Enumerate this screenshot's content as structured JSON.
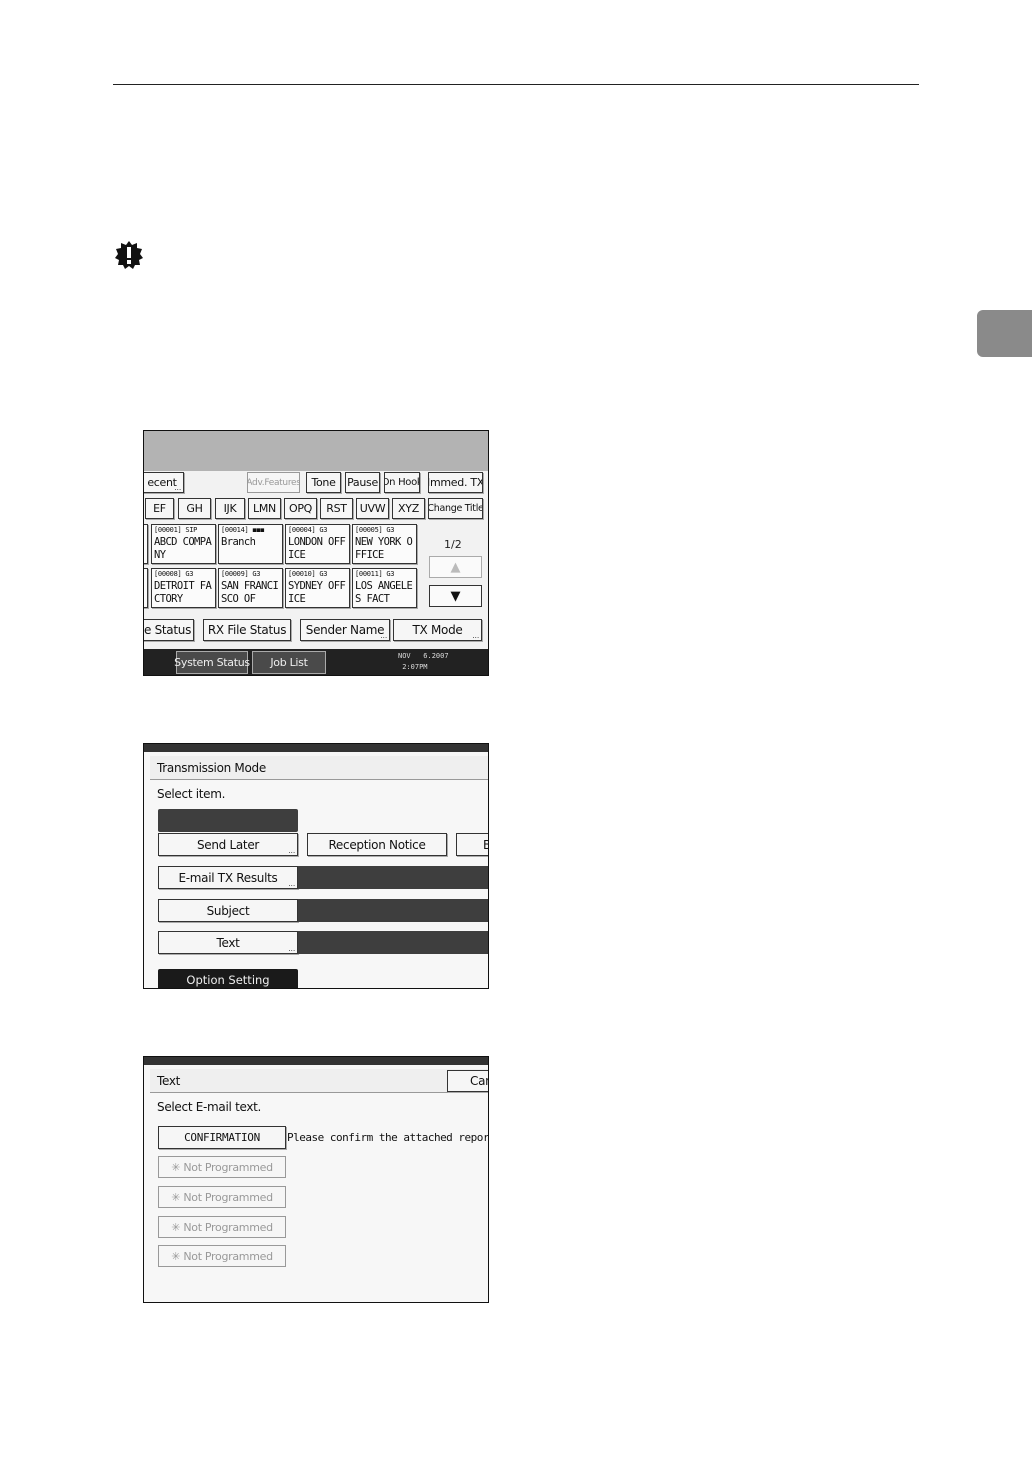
{
  "screen1": {
    "top_buttons": [
      "ecent",
      "Adv.Features",
      "Tone",
      "Pause",
      "On Hook",
      "Immed. TX"
    ],
    "index_tabs": [
      "EF",
      "GH",
      "IJK",
      "LMN",
      "OPQ",
      "RST",
      "UVW",
      "XYZ",
      "Change Title"
    ],
    "destinations": [
      {
        "code": "[00001] SIP",
        "name": "ABCD COMPA\nNY"
      },
      {
        "code": "[00014] ◼◼◼",
        "name": "Branch"
      },
      {
        "code": "[00004] G3",
        "name": "LONDON OFF\nICE"
      },
      {
        "code": "[00005] G3",
        "name": "NEW YORK O\nFFICE"
      },
      {
        "code": "[00008] G3",
        "name": "DETROIT FA\nCTORY"
      },
      {
        "code": "[00009] G3",
        "name": "SAN FRANCI\nSCO OF"
      },
      {
        "code": "[00010] G3",
        "name": "SYDNEY OFF\nICE"
      },
      {
        "code": "[00011] G3",
        "name": "LOS ANGELE\nS FACT"
      }
    ],
    "page_counter": "1/2",
    "up_arrow": "▲",
    "down_arrow": "▼",
    "bottom_buttons": [
      "le Status",
      "RX File Status",
      "Sender Name",
      "TX Mode"
    ],
    "status_buttons": [
      "System Status",
      "Job List"
    ],
    "datetime": "NOV   6.2007\n 2:07PM"
  },
  "screen2": {
    "title": "Transmission Mode",
    "prompt": "Select item.",
    "buttons": {
      "send_later": "Send Later",
      "reception_notice": "Reception Notice",
      "cut_off": "B",
      "email_tx_results": "E-mail TX Results",
      "subject": "Subject",
      "text": "Text",
      "option_setting": "Option Setting"
    }
  },
  "screen3": {
    "title": "Text",
    "cancel": "Can",
    "prompt": "Select E-mail text.",
    "confirmation": "CONFIRMATION",
    "preview": "Please confirm the attached report",
    "not_programmed": [
      "✳ Not Programmed",
      "✳ Not Programmed",
      "✳ Not Programmed",
      "✳ Not Programmed"
    ]
  }
}
